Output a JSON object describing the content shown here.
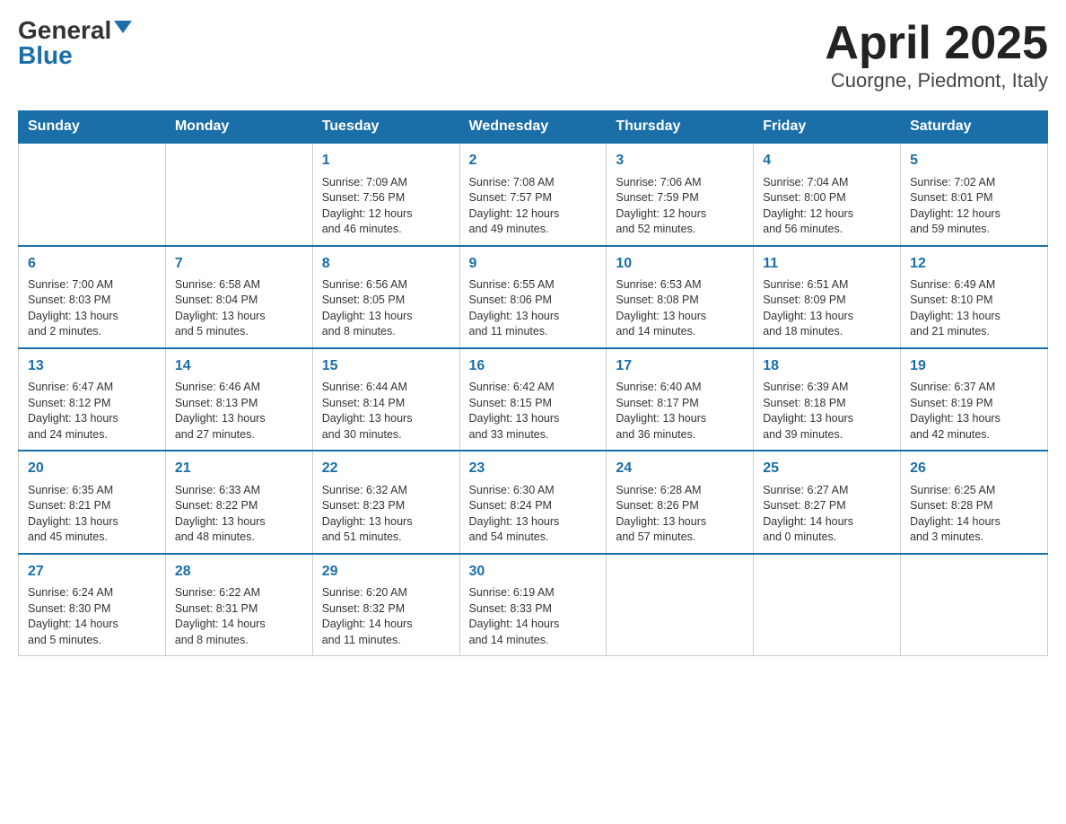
{
  "header": {
    "logo_general": "General",
    "logo_blue": "Blue",
    "title": "April 2025",
    "subtitle": "Cuorgne, Piedmont, Italy"
  },
  "days_of_week": [
    "Sunday",
    "Monday",
    "Tuesday",
    "Wednesday",
    "Thursday",
    "Friday",
    "Saturday"
  ],
  "weeks": [
    [
      {
        "day": "",
        "info": ""
      },
      {
        "day": "",
        "info": ""
      },
      {
        "day": "1",
        "info": "Sunrise: 7:09 AM\nSunset: 7:56 PM\nDaylight: 12 hours\nand 46 minutes."
      },
      {
        "day": "2",
        "info": "Sunrise: 7:08 AM\nSunset: 7:57 PM\nDaylight: 12 hours\nand 49 minutes."
      },
      {
        "day": "3",
        "info": "Sunrise: 7:06 AM\nSunset: 7:59 PM\nDaylight: 12 hours\nand 52 minutes."
      },
      {
        "day": "4",
        "info": "Sunrise: 7:04 AM\nSunset: 8:00 PM\nDaylight: 12 hours\nand 56 minutes."
      },
      {
        "day": "5",
        "info": "Sunrise: 7:02 AM\nSunset: 8:01 PM\nDaylight: 12 hours\nand 59 minutes."
      }
    ],
    [
      {
        "day": "6",
        "info": "Sunrise: 7:00 AM\nSunset: 8:03 PM\nDaylight: 13 hours\nand 2 minutes."
      },
      {
        "day": "7",
        "info": "Sunrise: 6:58 AM\nSunset: 8:04 PM\nDaylight: 13 hours\nand 5 minutes."
      },
      {
        "day": "8",
        "info": "Sunrise: 6:56 AM\nSunset: 8:05 PM\nDaylight: 13 hours\nand 8 minutes."
      },
      {
        "day": "9",
        "info": "Sunrise: 6:55 AM\nSunset: 8:06 PM\nDaylight: 13 hours\nand 11 minutes."
      },
      {
        "day": "10",
        "info": "Sunrise: 6:53 AM\nSunset: 8:08 PM\nDaylight: 13 hours\nand 14 minutes."
      },
      {
        "day": "11",
        "info": "Sunrise: 6:51 AM\nSunset: 8:09 PM\nDaylight: 13 hours\nand 18 minutes."
      },
      {
        "day": "12",
        "info": "Sunrise: 6:49 AM\nSunset: 8:10 PM\nDaylight: 13 hours\nand 21 minutes."
      }
    ],
    [
      {
        "day": "13",
        "info": "Sunrise: 6:47 AM\nSunset: 8:12 PM\nDaylight: 13 hours\nand 24 minutes."
      },
      {
        "day": "14",
        "info": "Sunrise: 6:46 AM\nSunset: 8:13 PM\nDaylight: 13 hours\nand 27 minutes."
      },
      {
        "day": "15",
        "info": "Sunrise: 6:44 AM\nSunset: 8:14 PM\nDaylight: 13 hours\nand 30 minutes."
      },
      {
        "day": "16",
        "info": "Sunrise: 6:42 AM\nSunset: 8:15 PM\nDaylight: 13 hours\nand 33 minutes."
      },
      {
        "day": "17",
        "info": "Sunrise: 6:40 AM\nSunset: 8:17 PM\nDaylight: 13 hours\nand 36 minutes."
      },
      {
        "day": "18",
        "info": "Sunrise: 6:39 AM\nSunset: 8:18 PM\nDaylight: 13 hours\nand 39 minutes."
      },
      {
        "day": "19",
        "info": "Sunrise: 6:37 AM\nSunset: 8:19 PM\nDaylight: 13 hours\nand 42 minutes."
      }
    ],
    [
      {
        "day": "20",
        "info": "Sunrise: 6:35 AM\nSunset: 8:21 PM\nDaylight: 13 hours\nand 45 minutes."
      },
      {
        "day": "21",
        "info": "Sunrise: 6:33 AM\nSunset: 8:22 PM\nDaylight: 13 hours\nand 48 minutes."
      },
      {
        "day": "22",
        "info": "Sunrise: 6:32 AM\nSunset: 8:23 PM\nDaylight: 13 hours\nand 51 minutes."
      },
      {
        "day": "23",
        "info": "Sunrise: 6:30 AM\nSunset: 8:24 PM\nDaylight: 13 hours\nand 54 minutes."
      },
      {
        "day": "24",
        "info": "Sunrise: 6:28 AM\nSunset: 8:26 PM\nDaylight: 13 hours\nand 57 minutes."
      },
      {
        "day": "25",
        "info": "Sunrise: 6:27 AM\nSunset: 8:27 PM\nDaylight: 14 hours\nand 0 minutes."
      },
      {
        "day": "26",
        "info": "Sunrise: 6:25 AM\nSunset: 8:28 PM\nDaylight: 14 hours\nand 3 minutes."
      }
    ],
    [
      {
        "day": "27",
        "info": "Sunrise: 6:24 AM\nSunset: 8:30 PM\nDaylight: 14 hours\nand 5 minutes."
      },
      {
        "day": "28",
        "info": "Sunrise: 6:22 AM\nSunset: 8:31 PM\nDaylight: 14 hours\nand 8 minutes."
      },
      {
        "day": "29",
        "info": "Sunrise: 6:20 AM\nSunset: 8:32 PM\nDaylight: 14 hours\nand 11 minutes."
      },
      {
        "day": "30",
        "info": "Sunrise: 6:19 AM\nSunset: 8:33 PM\nDaylight: 14 hours\nand 14 minutes."
      },
      {
        "day": "",
        "info": ""
      },
      {
        "day": "",
        "info": ""
      },
      {
        "day": "",
        "info": ""
      }
    ]
  ]
}
